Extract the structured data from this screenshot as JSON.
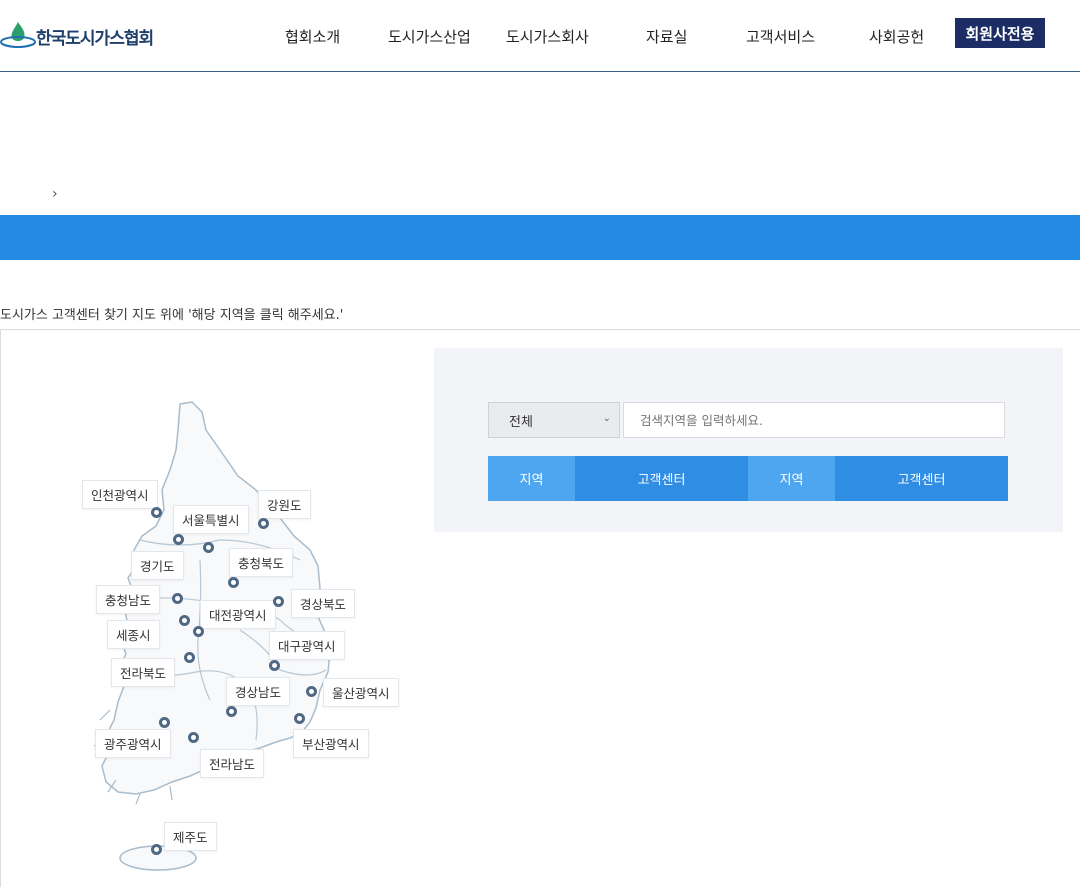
{
  "header": {
    "logo_text": "한국도시가스협회",
    "nav": [
      "협회소개",
      "도시가스산업",
      "도시가스회사",
      "자료실",
      "고객서비스",
      "사회공헌"
    ],
    "member_button": "회원사전용"
  },
  "breadcrumb": {
    "separator": "›"
  },
  "instruction": "도시가스 고객센터 찾기 지도 위에 '해당 지역을 클릭 해주세요.'",
  "map": {
    "regions": [
      "인천광역시",
      "서울특별시",
      "강원도",
      "경기도",
      "충청북도",
      "충청남도",
      "대전광역시",
      "경상북도",
      "세종시",
      "대구광역시",
      "전라북도",
      "경상남도",
      "울산광역시",
      "광주광역시",
      "부산광역시",
      "전라남도",
      "제주도"
    ]
  },
  "search": {
    "select_value": "전체",
    "input_placeholder": "검색지역을 입력하세요.",
    "input_value": "",
    "columns": [
      "지역",
      "고객센터",
      "지역",
      "고객센터"
    ]
  },
  "colors": {
    "accent_band": "#258ae3",
    "member_button": "#1c2d66",
    "column_region": "#4ea5f0",
    "column_center": "#2f8de4",
    "pin": "#4f6884"
  }
}
